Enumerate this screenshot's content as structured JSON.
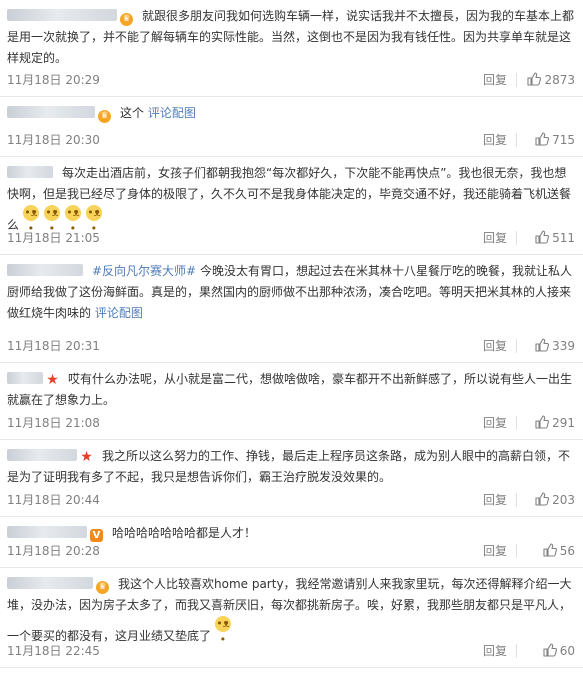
{
  "comments": [
    {
      "text": "就跟很多朋友问我如何选购车辆一样，说实话我并不太擅長，因为我的车基本上都是用一次就换了，并不能了解每辆车的实际性能。当然，这倒也不是因为我有钱任性。因为共享单车就是这样规定的。",
      "link": "",
      "emoji_count": 0,
      "time": "11月18日 20:29",
      "reply": "回复",
      "likes": "2873",
      "badge": "crown"
    },
    {
      "text": "这个",
      "link": "评论配图",
      "emoji_count": 0,
      "time": "11月18日 20:30",
      "reply": "回复",
      "likes": "715",
      "badge": "crown"
    },
    {
      "text": "每次走出酒店前，女孩子们都朝我抱怨“每次都好久，下次能不能再快点”。我也很无奈，我也想快啊，但是我已经尽了身体的极限了，久不久可不是我身体能决定的，毕竟交通不好，我还能骑着飞机送餐么",
      "link": "",
      "emoji_count": 4,
      "time": "11月18日 21:05",
      "reply": "回复",
      "likes": "511",
      "badge": "none"
    },
    {
      "text": "今晚没太有胃口，想起过去在米其林十八星餐厅吃的晚餐，我就让私人厨师给我做了这份海鲜面。真是的，果然国内的厨师做不出那种浓汤，凑合吃吧。等明天把米其林的人接来做红烧牛肉味的",
      "hashtag": "#反向凡尔赛大师#",
      "link": "评论配图",
      "emoji_count": 0,
      "time": "11月18日 20:31",
      "reply": "回复",
      "likes": "339",
      "badge": "none"
    },
    {
      "text": "哎有什么办法呢，从小就是富二代，想做啥做啥，豪车都开不出新鲜感了，所以说有些人一出生就赢在了想象力上。",
      "link": "",
      "emoji_count": 0,
      "time": "11月18日 21:08",
      "reply": "回复",
      "likes": "291",
      "badge": "star"
    },
    {
      "text": "我之所以这么努力的工作、挣钱，最后走上程序员这条路，成为别人眼中的高薪白领，不是为了证明我有多了不起，我只是想告诉你们，霸王治疗脱发没效果的。",
      "link": "",
      "emoji_count": 0,
      "time": "11月18日 20:44",
      "reply": "回复",
      "likes": "203",
      "badge": "star"
    },
    {
      "text": "哈哈哈哈哈哈哈都是人才！",
      "link": "",
      "emoji_count": 0,
      "time": "11月18日 20:28",
      "reply": "回复",
      "likes": "56",
      "badge": "vip"
    },
    {
      "text": "我这个人比较喜欢home party，我经常邀请别人来我家里玩，每次还得解释介绍一大堆，没办法，因为房子太多了，而我又喜新厌旧，每次都挑新房子。唉，好累，我那些朋友都只是平凡人，一个要买的都没有，这月业绩又垫底了",
      "link": "",
      "emoji_count": 1,
      "time": "11月18日 22:45",
      "reply": "回复",
      "likes": "60",
      "badge": "crown"
    }
  ],
  "colors": {
    "link": "#4f7cb8",
    "meta": "#808080",
    "text": "#333333",
    "divider": "#e8e8e8"
  },
  "icons": {
    "like": "thumbs-up-icon",
    "emoji": "doge-emoji-icon",
    "crown": "crown-badge-icon",
    "star": "star-badge-icon",
    "vip": "vip-badge-icon"
  }
}
